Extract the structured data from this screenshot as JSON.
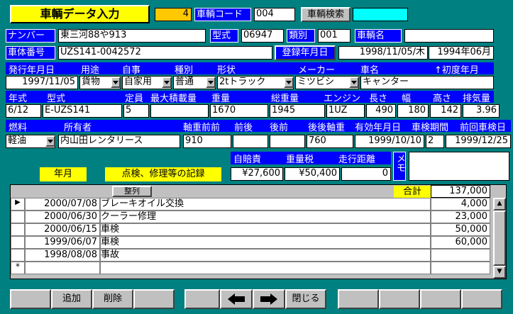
{
  "header": {
    "title": "車輌データ入力",
    "record_no": "4",
    "code_label": "車輌コード",
    "code_value": "004",
    "search_button": "車輌検索",
    "search_value": ""
  },
  "row1": {
    "number_label": "ナンバー",
    "number_value": "東三河88や913",
    "model_label": "型式",
    "model_value": "06947",
    "class_label": "類別",
    "class_value": "001",
    "name_label": "車輌名",
    "name_value": ""
  },
  "row2": {
    "chassis_label": "車体番号",
    "chassis_value": "UZS141-0042572",
    "regdate_label": "登録年月日",
    "regdate_value": "1998/11/05/木",
    "first_reg_value": "1994年06月"
  },
  "row3": {
    "headers": [
      "発行年月日",
      "用途",
      "自事",
      "種別",
      "形状",
      "メーカー",
      "車名",
      "↑初度年月"
    ],
    "issue_date": "1997/11/05",
    "usage": "貨物",
    "own": "自家用",
    "type": "普通",
    "shape": "2tトラック",
    "maker": "ミツビシ",
    "car_name": "キャンター"
  },
  "row4": {
    "headers": [
      "年式",
      "型式",
      "定員",
      "最大積載量",
      "重量",
      "総重量",
      "エンジン",
      "長さ",
      "幅",
      "高さ",
      "排気量"
    ],
    "year": "6/12",
    "model": "E-UZS141",
    "capacity": "5",
    "max_load": "",
    "weight": "1670",
    "gross_weight": "1945",
    "engine": "1UZ",
    "length": "490",
    "width": "180",
    "height": "142",
    "displacement": "3.96"
  },
  "row5": {
    "headers": [
      "燃料",
      "所有者",
      "軸重前前",
      "前後",
      "後前",
      "後後軸重",
      "有効年月日",
      "車検期間",
      "前回車検日"
    ],
    "fuel": "軽油",
    "owner": "内山田レンタリース",
    "axle_ff": "910",
    "axle_fr": "",
    "axle_rf": "",
    "axle_rr": "760",
    "valid_date": "1999/10/10",
    "inspection_period": "2",
    "last_inspection": "1999/12/25"
  },
  "costs": {
    "headers": [
      "自賠責",
      "重量税",
      "走行距離"
    ],
    "liability": "¥27,600",
    "weight_tax": "¥50,400",
    "mileage": "0",
    "memo_label": "メモ",
    "memo_value": ""
  },
  "records": {
    "date_label": "年月",
    "title": "点検、修理等の記録",
    "sort_button": "整列",
    "total_label": "合計",
    "total_value": "137,000",
    "rows": [
      {
        "date": "2000/07/08",
        "desc": "ブレーキオイル交換",
        "amount": "4,000"
      },
      {
        "date": "2000/06/30",
        "desc": "クーラー修理",
        "amount": "23,000"
      },
      {
        "date": "2000/06/15",
        "desc": "車検",
        "amount": "50,000"
      },
      {
        "date": "1999/06/07",
        "desc": "車検",
        "amount": "60,000"
      },
      {
        "date": "1998/08/08",
        "desc": "事故",
        "amount": ""
      }
    ]
  },
  "footer": {
    "add": "追加",
    "delete": "削除",
    "close": "閉じる"
  }
}
